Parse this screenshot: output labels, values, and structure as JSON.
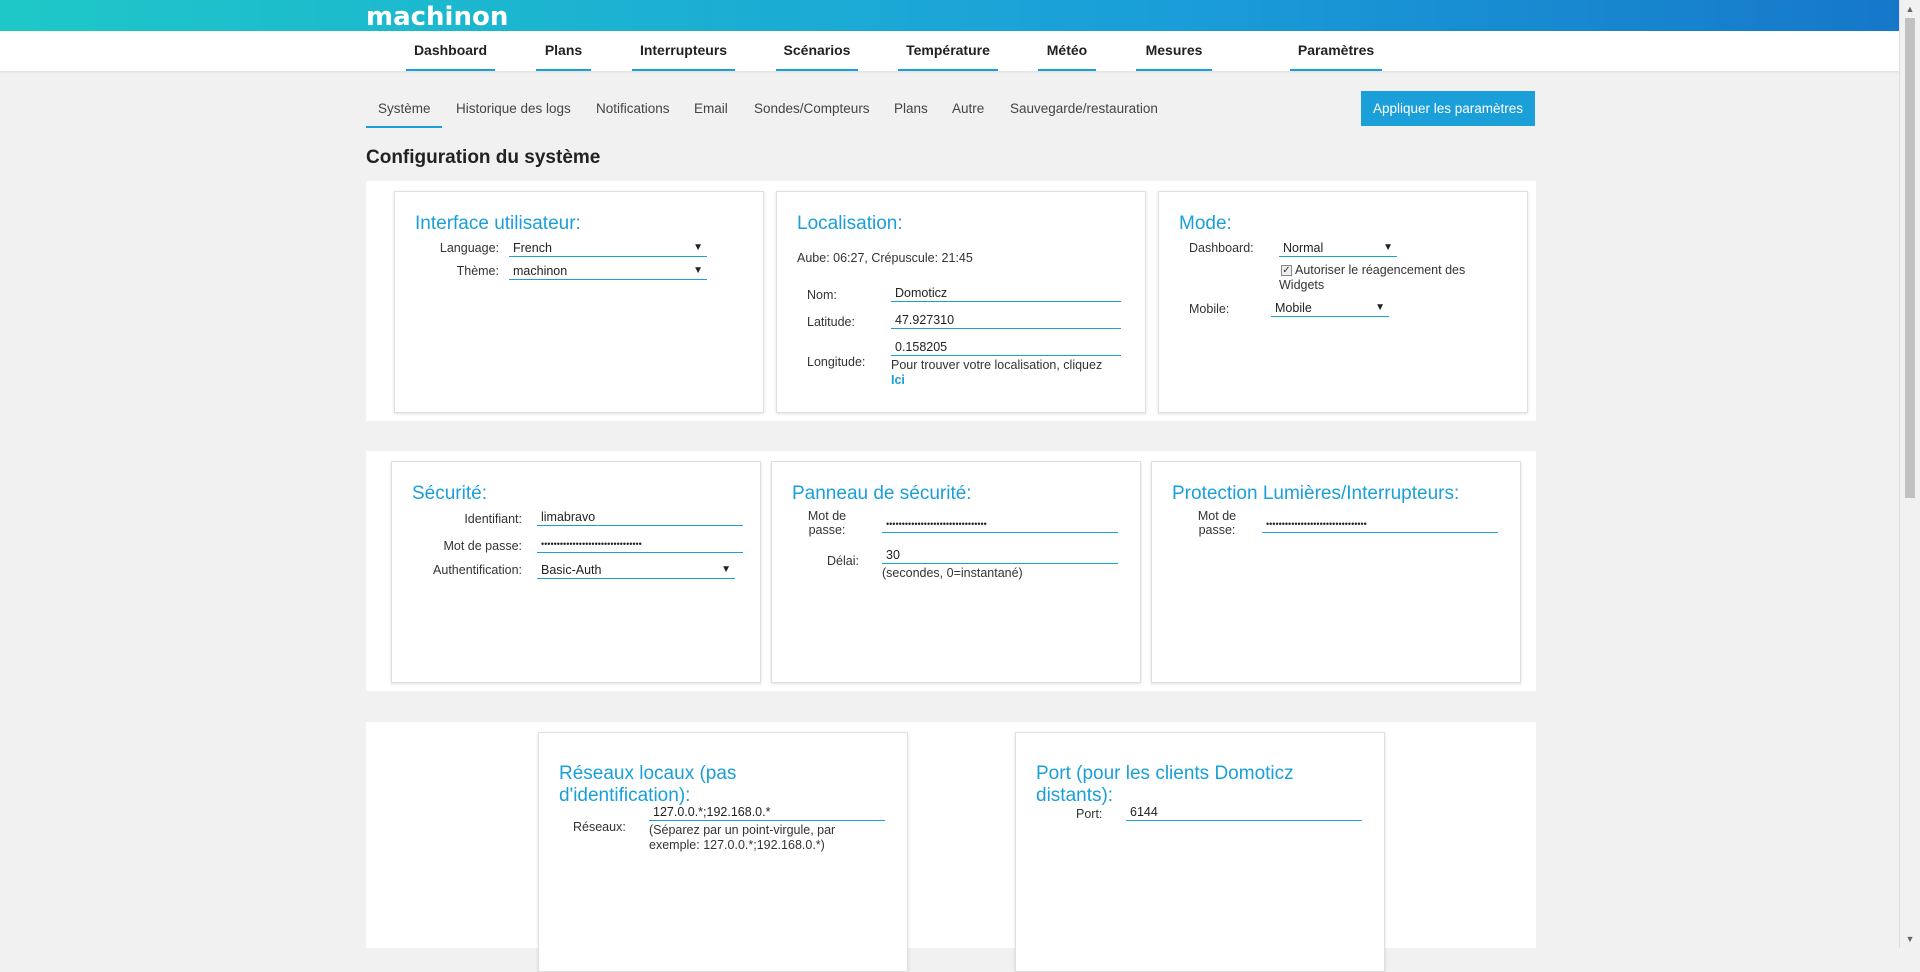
{
  "brand": {
    "logo_text": "machinon"
  },
  "nav": {
    "items": [
      {
        "label": "Dashboard"
      },
      {
        "label": "Plans"
      },
      {
        "label": "Interrupteurs"
      },
      {
        "label": "Scénarios"
      },
      {
        "label": "Température"
      },
      {
        "label": "Météo"
      },
      {
        "label": "Mesures"
      },
      {
        "label": "Paramètres"
      }
    ]
  },
  "subtabs": {
    "items": [
      {
        "label": "Système"
      },
      {
        "label": "Historique des logs"
      },
      {
        "label": "Notifications"
      },
      {
        "label": "Email"
      },
      {
        "label": "Sondes/Compteurs"
      },
      {
        "label": "Plans"
      },
      {
        "label": "Autre"
      },
      {
        "label": "Sauvegarde/restauration"
      }
    ],
    "active": "Système"
  },
  "apply_button": "Appliquer les paramètres",
  "page_title": "Configuration du système",
  "ui_card": {
    "title": "Interface utilisateur:",
    "language_label": "Language:",
    "language_value": "French",
    "theme_label": "Thème:",
    "theme_value": "machinon"
  },
  "location_card": {
    "title": "Localisation:",
    "sun_info": "Aube: 06:27, Crépuscule: 21:45",
    "name_label": "Nom:",
    "name_value": "Domoticz",
    "latitude_label": "Latitude:",
    "latitude_value": "47.927310",
    "longitude_label": "Longitude:",
    "longitude_value": "0.158205",
    "find_hint": "Pour trouver votre localisation, cliquez",
    "find_link": "Ici"
  },
  "mode_card": {
    "title": "Mode:",
    "dashboard_label": "Dashboard:",
    "dashboard_value": "Normal",
    "widgets_checkbox_label": "Autoriser le réagencement des Widgets",
    "widgets_checked": true,
    "mobile_label": "Mobile:",
    "mobile_value": "Mobile"
  },
  "security_card": {
    "title": "Sécurité:",
    "username_label": "Identifiant:",
    "username_value": "limabravo",
    "password_label": "Mot de passe:",
    "password_value": "••••••••••••••••••••••••••••••••",
    "auth_label": "Authentification:",
    "auth_value": "Basic-Auth"
  },
  "panel_card": {
    "title": "Panneau de sécurité:",
    "password_label_1": "Mot de",
    "password_label_2": "passe:",
    "password_value": "••••••••••••••••••••••••••••••••",
    "delay_label": "Délai:",
    "delay_value": "30",
    "delay_hint": "(secondes, 0=instantané)"
  },
  "protection_card": {
    "title": "Protection Lumières/Interrupteurs:",
    "password_label_1": "Mot de",
    "password_label_2": "passe:",
    "password_value": "••••••••••••••••••••••••••••••••"
  },
  "networks_card": {
    "title_1": "Réseaux locaux (pas",
    "title_2": "d'identification):",
    "networks_label": "Réseaux:",
    "networks_value": "127.0.0.*;192.168.0.*",
    "networks_hint_1": "(Séparez par un point-virgule, par",
    "networks_hint_2": "exemple: 127.0.0.*;192.168.0.*)"
  },
  "port_card": {
    "title_1": "Port (pour les clients Domoticz",
    "title_2": "distants):",
    "port_label": "Port:",
    "port_value": "6144"
  },
  "colors": {
    "accent": "#1a9fd9",
    "page_bg": "#f1f1f1"
  }
}
